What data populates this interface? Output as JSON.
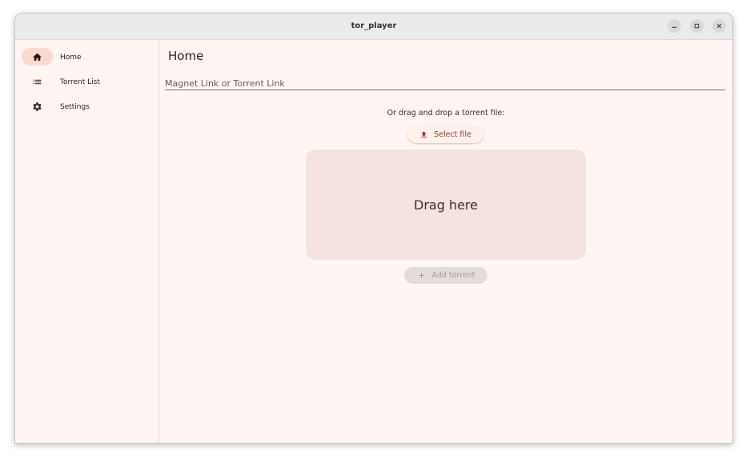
{
  "window": {
    "title": "tor_player"
  },
  "sidebar": {
    "items": [
      {
        "label": "Home",
        "icon": "home-icon",
        "active": true
      },
      {
        "label": "Torrent List",
        "icon": "list-icon",
        "active": false
      },
      {
        "label": "Settings",
        "icon": "gear-icon",
        "active": false
      }
    ]
  },
  "main": {
    "title": "Home",
    "magnet_placeholder": "Magnet Link or Torrent Link",
    "magnet_value": "",
    "drag_drop_text": "Or drag and drop a torrent file:",
    "select_file_label": "Select file",
    "drop_zone_label": "Drag here",
    "add_torrent_label": "Add torrent",
    "add_torrent_enabled": false
  },
  "colors": {
    "accent": "#8d3b2b",
    "active_nav_bg": "#fbd9d0",
    "drop_zone_bg": "#f5e3e1",
    "background": "#fff6f4"
  }
}
